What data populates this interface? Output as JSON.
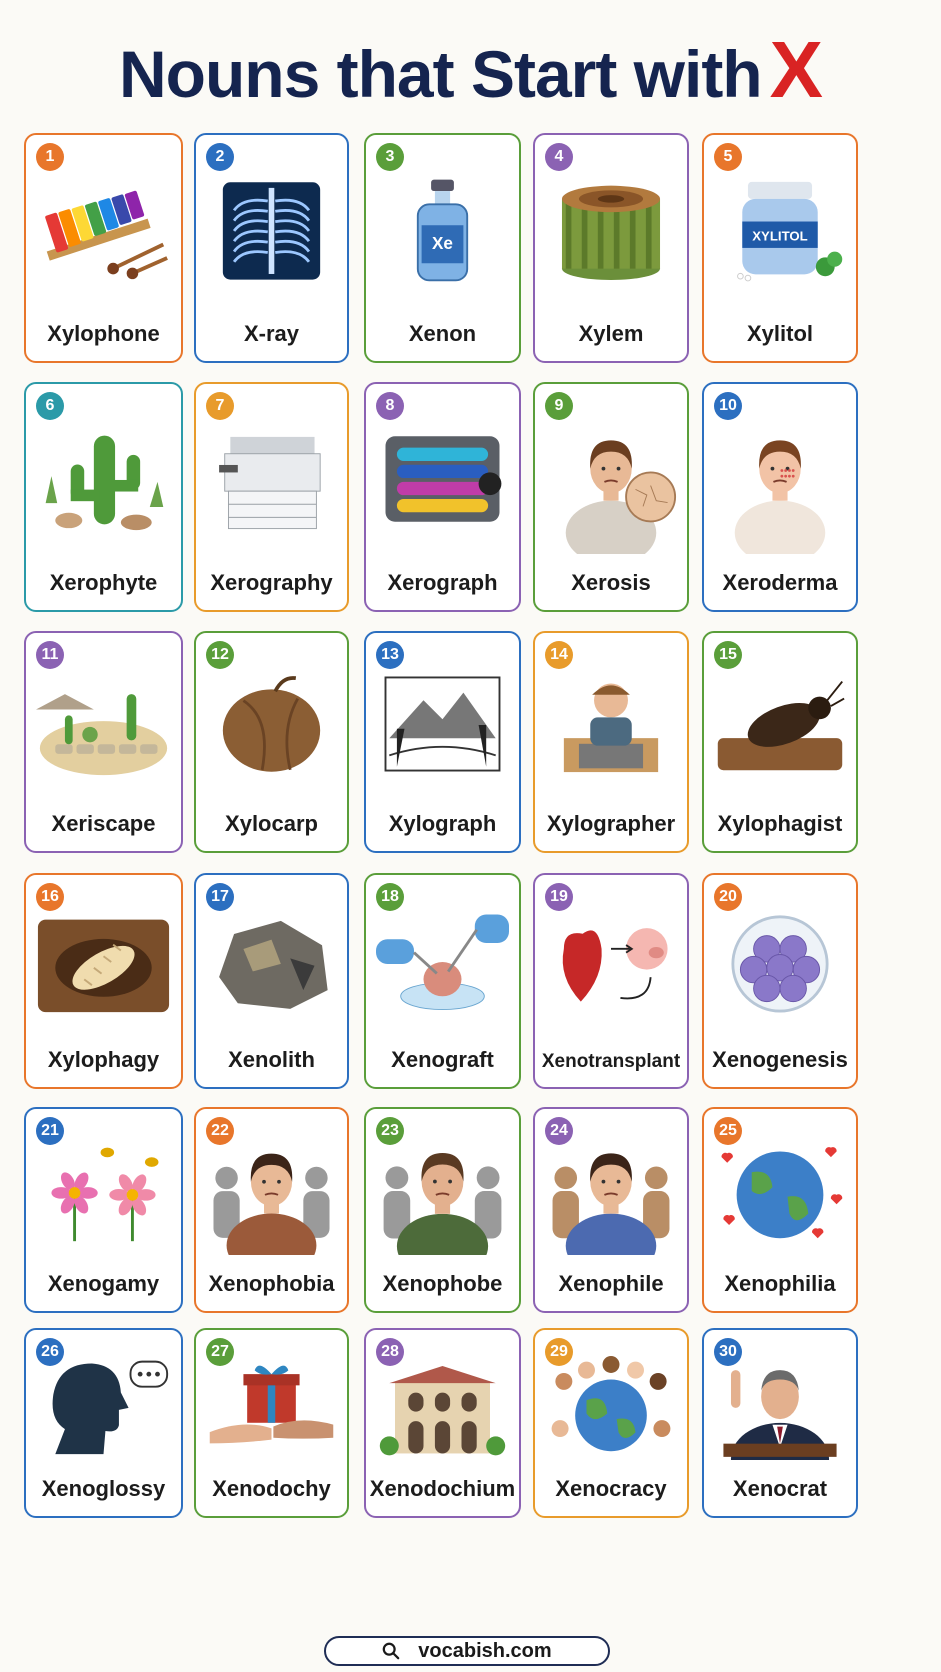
{
  "title": {
    "text": "Nouns that Start with",
    "letter": "X"
  },
  "footer": {
    "url": "vocabish.com",
    "icon": "search-icon"
  },
  "cards": [
    {
      "num": "1",
      "word": "Xylophone",
      "color": "#e8762b",
      "icon": "xylophone-icon"
    },
    {
      "num": "2",
      "word": "X-ray",
      "color": "#2c6fc0",
      "icon": "x-ray-icon"
    },
    {
      "num": "3",
      "word": "Xenon",
      "color": "#5a9e3a",
      "icon": "xenon-bottle-icon"
    },
    {
      "num": "4",
      "word": "Xylem",
      "color": "#8b62b3",
      "icon": "tree-stump-icon"
    },
    {
      "num": "5",
      "word": "Xylitol",
      "color": "#e8762b",
      "icon": "xylitol-jar-icon"
    },
    {
      "num": "6",
      "word": "Xerophyte",
      "color": "#2b9aa8",
      "icon": "cactus-icon"
    },
    {
      "num": "7",
      "word": "Xerography",
      "color": "#e89b2b",
      "icon": "photocopier-icon"
    },
    {
      "num": "8",
      "word": "Xerograph",
      "color": "#8b62b3",
      "icon": "printer-drum-icon"
    },
    {
      "num": "9",
      "word": "Xerosis",
      "color": "#5a9e3a",
      "icon": "dry-skin-face-icon"
    },
    {
      "num": "10",
      "word": "Xeroderma",
      "color": "#2c6fc0",
      "icon": "skin-rash-profile-icon"
    },
    {
      "num": "11",
      "word": "Xeriscape",
      "color": "#8b62b3",
      "icon": "desert-garden-icon"
    },
    {
      "num": "12",
      "word": "Xylocarp",
      "color": "#5a9e3a",
      "icon": "woody-fruit-icon"
    },
    {
      "num": "13",
      "word": "Xylograph",
      "color": "#2c6fc0",
      "icon": "woodcut-print-icon"
    },
    {
      "num": "14",
      "word": "Xylographer",
      "color": "#e89b2b",
      "icon": "wood-engraver-icon"
    },
    {
      "num": "15",
      "word": "Xylophagist",
      "color": "#5a9e3a",
      "icon": "beetle-icon"
    },
    {
      "num": "16",
      "word": "Xylophagy",
      "color": "#e8762b",
      "icon": "wood-larva-icon"
    },
    {
      "num": "17",
      "word": "Xenolith",
      "color": "#2c6fc0",
      "icon": "rock-icon"
    },
    {
      "num": "18",
      "word": "Xenograft",
      "color": "#5a9e3a",
      "icon": "tissue-graft-icon"
    },
    {
      "num": "19",
      "word": "Xenotransplant",
      "color": "#8b62b3",
      "icon": "heart-pig-icon"
    },
    {
      "num": "20",
      "word": "Xenogenesis",
      "color": "#e8762b",
      "icon": "cell-cluster-icon"
    },
    {
      "num": "21",
      "word": "Xenogamy",
      "color": "#2c6fc0",
      "icon": "flower-bees-icon"
    },
    {
      "num": "22",
      "word": "Xenophobia",
      "color": "#e8762b",
      "icon": "anxious-woman-icon"
    },
    {
      "num": "23",
      "word": "Xenophobe",
      "color": "#5a9e3a",
      "icon": "wary-man-icon"
    },
    {
      "num": "24",
      "word": "Xenophile",
      "color": "#8b62b3",
      "icon": "welcoming-woman-icon"
    },
    {
      "num": "25",
      "word": "Xenophilia",
      "color": "#e8762b",
      "icon": "globe-hearts-icon"
    },
    {
      "num": "26",
      "word": "Xenoglossy",
      "color": "#2c6fc0",
      "icon": "speaking-head-icon"
    },
    {
      "num": "27",
      "word": "Xenodochy",
      "color": "#5a9e3a",
      "icon": "gift-hands-icon"
    },
    {
      "num": "28",
      "word": "Xenodochium",
      "color": "#8b62b3",
      "icon": "guesthouse-icon"
    },
    {
      "num": "29",
      "word": "Xenocracy",
      "color": "#e89b2b",
      "icon": "globe-people-icon"
    },
    {
      "num": "30",
      "word": "Xenocrat",
      "color": "#2c6fc0",
      "icon": "politician-icon"
    }
  ]
}
